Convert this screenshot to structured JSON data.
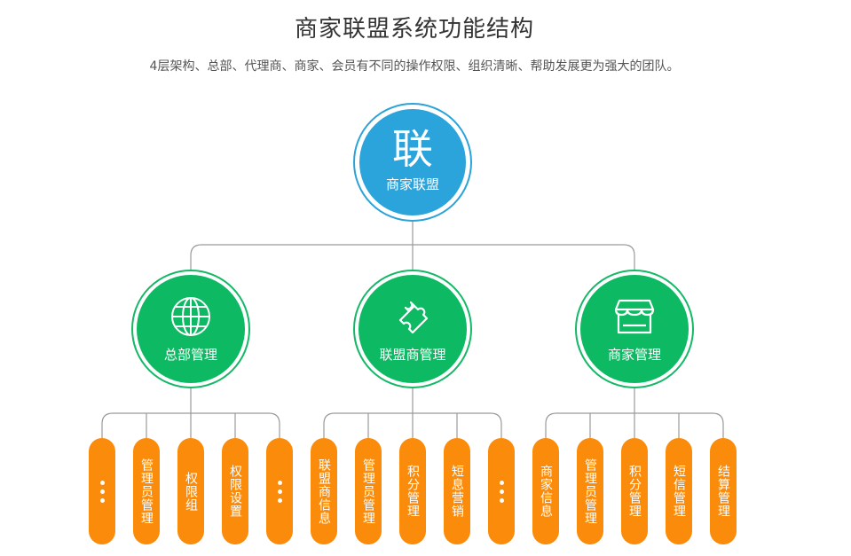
{
  "header": {
    "title": "商家联盟系统功能结构",
    "subtitle": "4层架构、总部、代理商、商家、会员有不同的操作权限、组织清晰、帮助发展更为强大的团队。"
  },
  "root": {
    "glyph": "联",
    "label": "商家联盟"
  },
  "groups": [
    {
      "label": "总部管理",
      "icon": "globe-icon",
      "items": [
        "…",
        "管理员管理",
        "权限组",
        "权限设置",
        "…"
      ]
    },
    {
      "label": "联盟商管理",
      "icon": "puzzle-tag-icon",
      "items": [
        "联盟商信息",
        "管理员管理",
        "积分管理",
        "短息营销",
        "…"
      ]
    },
    {
      "label": "商家管理",
      "icon": "storefront-icon",
      "items": [
        "商家信息",
        "管理员管理",
        "积分管理",
        "短信管理",
        "结算管理"
      ]
    }
  ],
  "colors": {
    "root": "#2aa4db",
    "group": "#0dba63",
    "item": "#fb8c0b",
    "line": "#9a9a9a"
  }
}
